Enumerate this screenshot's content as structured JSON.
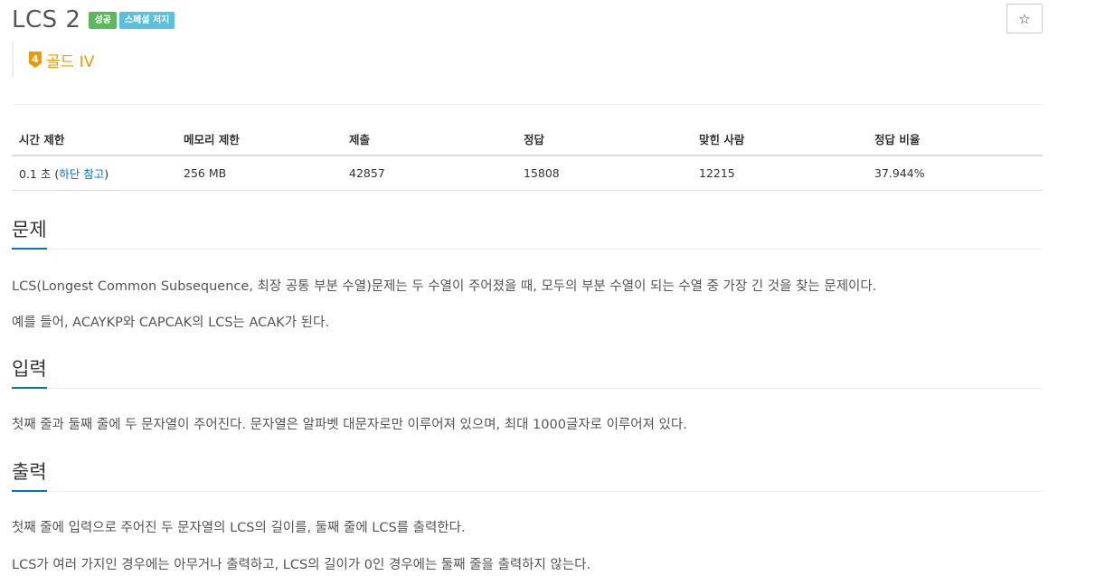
{
  "problem": {
    "title": "LCS 2",
    "labels": {
      "success": "성공",
      "special_judge": "스페셜 저지"
    },
    "star_button": "☆",
    "tier": {
      "number": "4",
      "text": "골드 IV",
      "color": "#ec9a00"
    }
  },
  "info_table": {
    "headers": [
      "시간 제한",
      "메모리 제한",
      "제출",
      "정답",
      "맞힌 사람",
      "정답 비율"
    ],
    "time_limit": "0.1 초 ",
    "time_note_open": "(",
    "time_note_link": "하단 참고",
    "time_note_close": ")",
    "memory": "256 MB",
    "submissions": "42857",
    "accepted": "15808",
    "solvers": "12215",
    "ratio": "37.944%"
  },
  "sections": {
    "description": {
      "heading": "문제",
      "paragraphs": [
        "LCS(Longest Common Subsequence, 최장 공통 부분 수열)문제는 두 수열이 주어졌을 때, 모두의 부분 수열이 되는 수열 중 가장 긴 것을 찾는 문제이다.",
        "예를 들어, ACAYKP와 CAPCAK의 LCS는 ACAK가 된다."
      ]
    },
    "input": {
      "heading": "입력",
      "paragraphs": [
        "첫째 줄과 둘째 줄에 두 문자열이 주어진다. 문자열은 알파벳 대문자로만 이루어져 있으며, 최대 1000글자로 이루어져 있다."
      ]
    },
    "output": {
      "heading": "출력",
      "paragraphs": [
        "첫째 줄에 입력으로 주어진 두 문자열의 LCS의 길이를, 둘째 줄에 LCS를 출력한다.",
        "LCS가 여러 가지인 경우에는 아무거나 출력하고, LCS의 길이가 0인 경우에는 둘째 줄을 출력하지 않는다."
      ]
    }
  },
  "colors": {
    "accent": "#0076c0",
    "label_success": "#5cb85c",
    "label_info": "#5bc0de"
  }
}
